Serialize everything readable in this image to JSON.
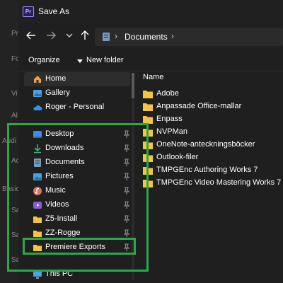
{
  "window": {
    "title": "Save As",
    "app_logo": "Pr"
  },
  "background_fragments": [
    "Pr",
    "Fo",
    "Vi",
    "Al",
    "Audi",
    "Ac",
    "Basic",
    "Sa",
    "Sa",
    "Sa"
  ],
  "address_bar": {
    "path": [
      "Documents"
    ]
  },
  "toolbar": {
    "organize_label": "Organize",
    "new_folder_label": "New folder"
  },
  "nav": {
    "top": [
      {
        "label": "Home",
        "icon": "home-icon",
        "selected": true
      },
      {
        "label": "Gallery",
        "icon": "gallery-icon"
      },
      {
        "label": "Roger - Personal",
        "icon": "cloud-icon"
      }
    ],
    "quick_access": [
      {
        "label": "Desktop",
        "icon": "desktop-icon",
        "color": "#3a8ee6"
      },
      {
        "label": "Downloads",
        "icon": "download-icon",
        "color": "#3fb37a"
      },
      {
        "label": "Documents",
        "icon": "document-icon",
        "color": "#7a9bb8"
      },
      {
        "label": "Pictures",
        "icon": "pictures-icon",
        "color": "#4aa3df"
      },
      {
        "label": "Music",
        "icon": "music-icon",
        "color": "#e0705a"
      },
      {
        "label": "Videos",
        "icon": "videos-icon",
        "color": "#8a5bd6"
      },
      {
        "label": "Z5-Install",
        "icon": "folder-icon",
        "color": "#f4c542"
      },
      {
        "label": "ZZ-Rogge",
        "icon": "folder-icon",
        "color": "#f4c542"
      },
      {
        "label": "Premiere Exports",
        "icon": "folder-icon",
        "color": "#f4c542"
      }
    ],
    "bottom": [
      {
        "label": "This PC",
        "icon": "pc-icon"
      }
    ]
  },
  "file_list": {
    "column_name": "Name",
    "items": [
      "Adobe",
      "Anpassade Office-mallar",
      "Enpass",
      "NVPMan",
      "OneNote-anteckningsböcker",
      "Outlook-filer",
      "TMPGEnc Authoring Works 7",
      "TMPGEnc Video Mastering Works 7"
    ]
  },
  "colors": {
    "highlight": "#29a84a",
    "folder": "#f4c542",
    "background": "#1c1c1c"
  }
}
